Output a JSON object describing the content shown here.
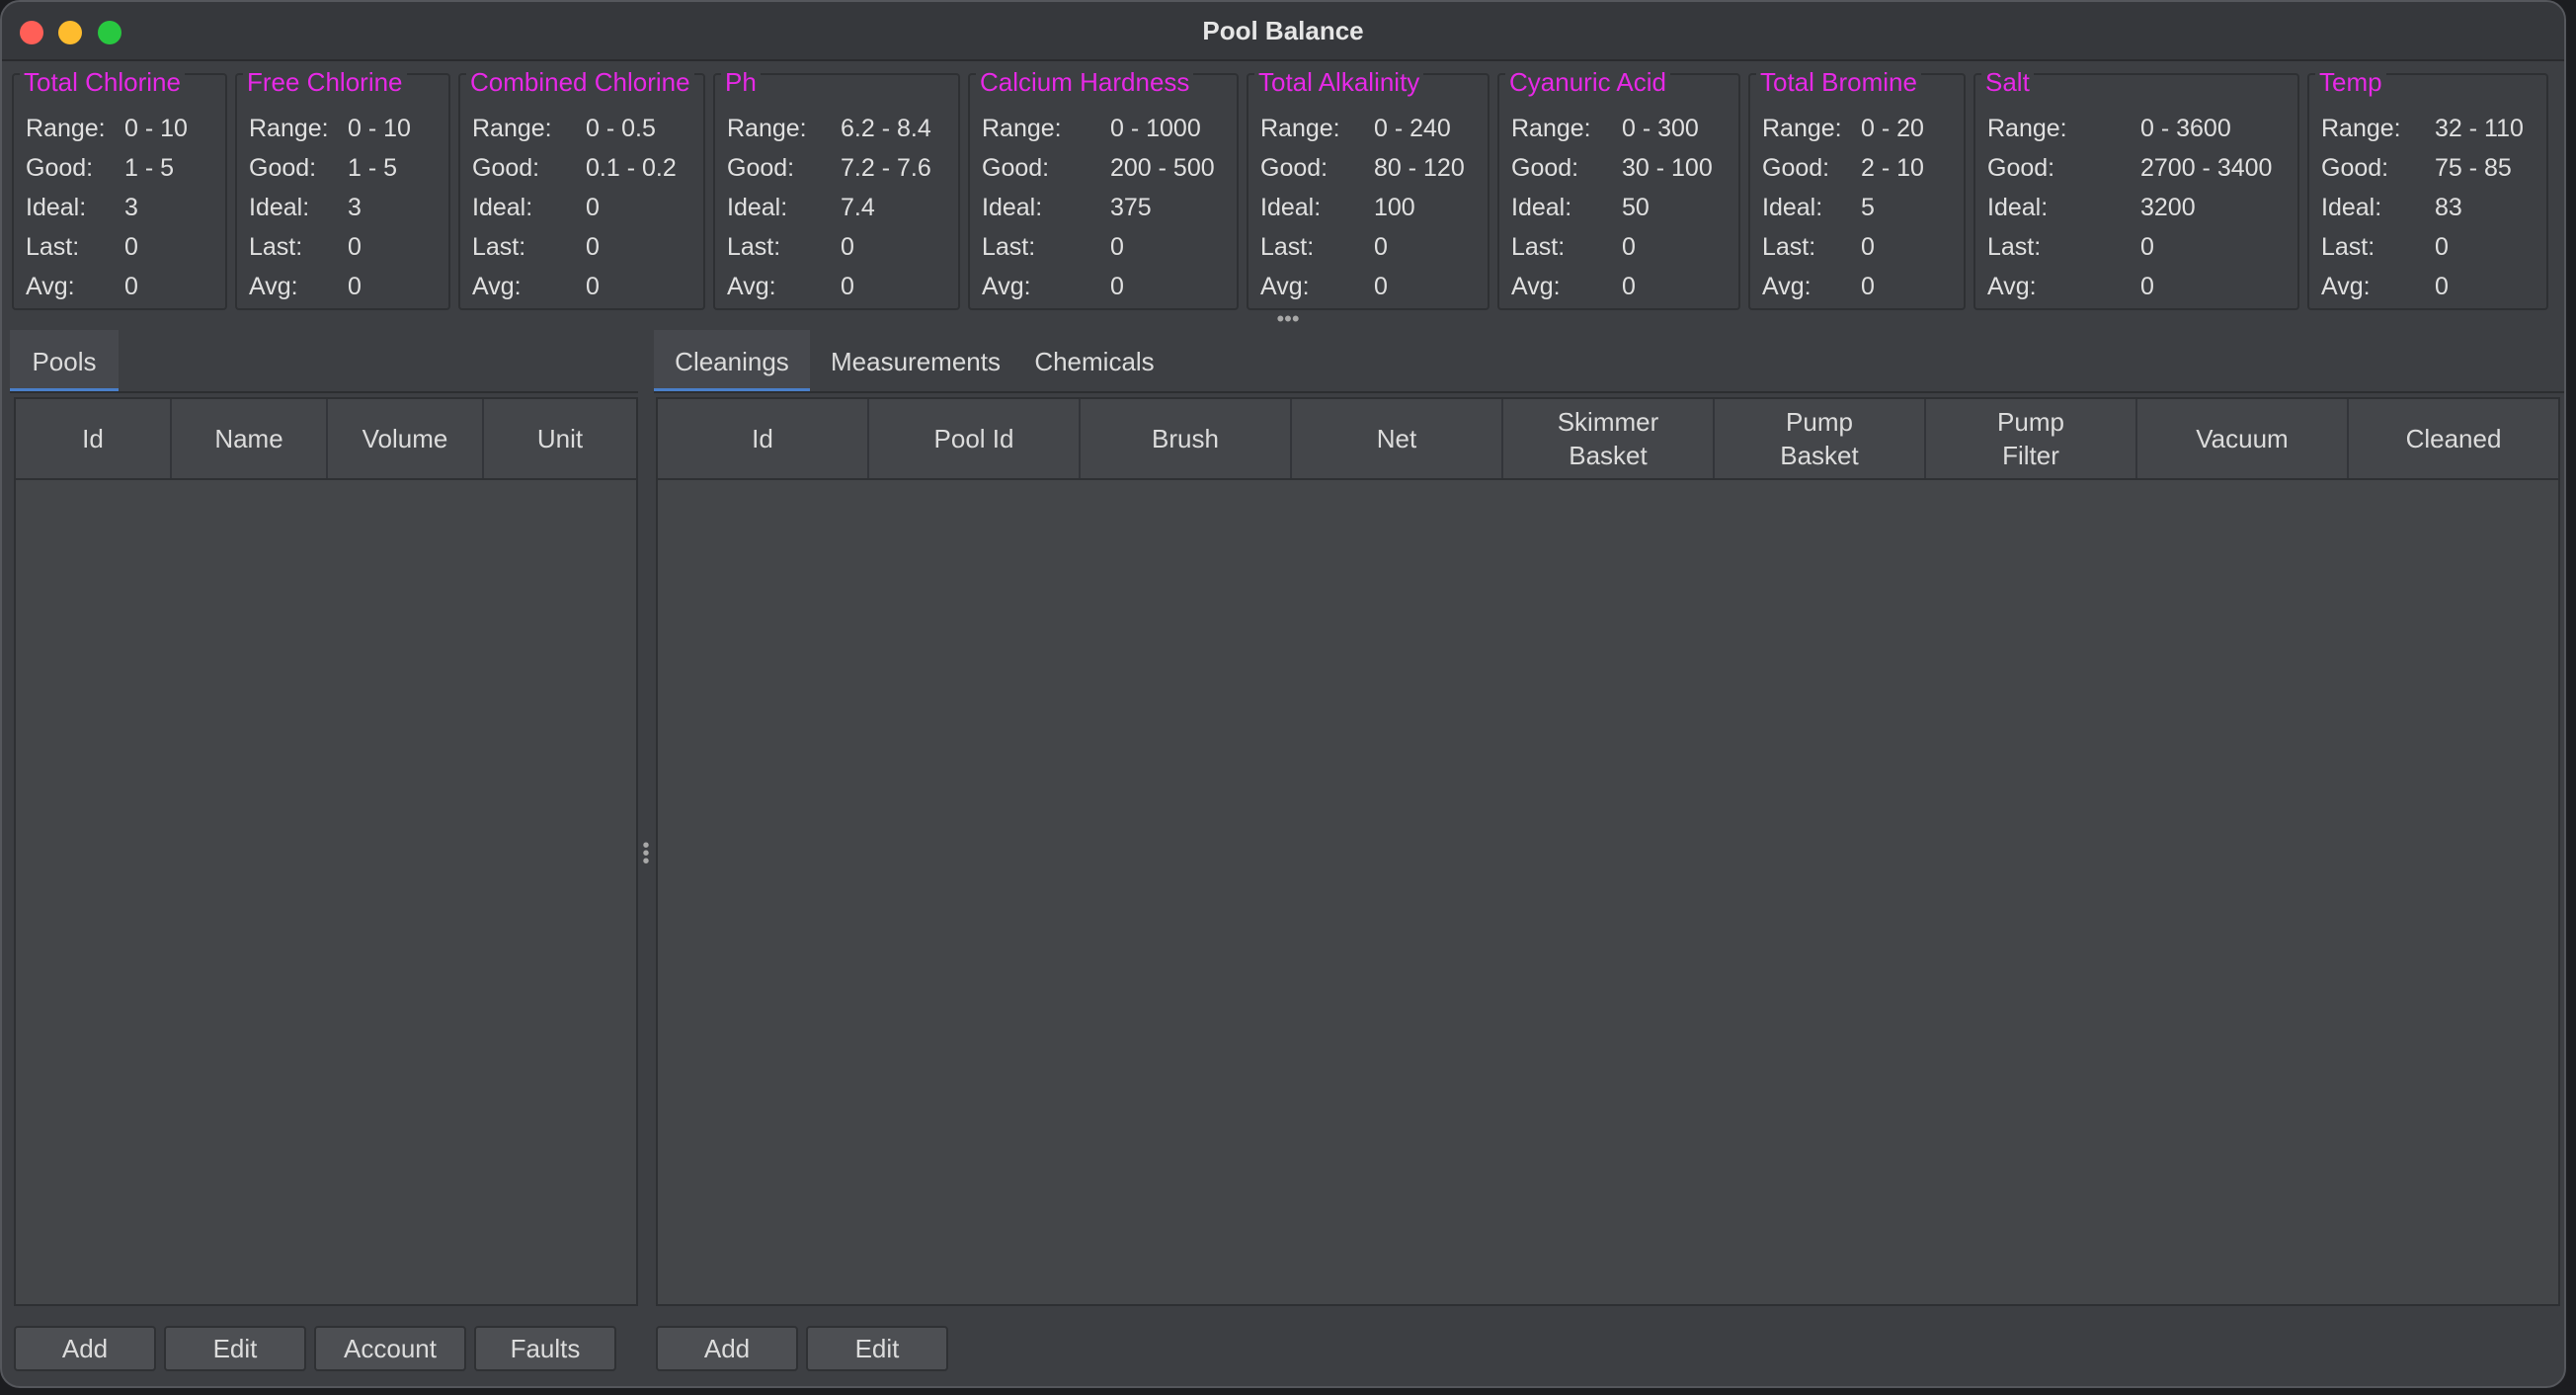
{
  "window": {
    "title": "Pool Balance"
  },
  "parameters": [
    {
      "name": "Total Chlorine",
      "range": "0 - 10",
      "good": "1 - 5",
      "ideal": "3",
      "last": "0",
      "avg": "0"
    },
    {
      "name": "Free Chlorine",
      "range": "0 - 10",
      "good": "1 - 5",
      "ideal": "3",
      "last": "0",
      "avg": "0"
    },
    {
      "name": "Combined Chlorine",
      "range": "0 - 0.5",
      "good": "0.1 - 0.2",
      "ideal": "0",
      "last": "0",
      "avg": "0"
    },
    {
      "name": "Ph",
      "range": "6.2 - 8.4",
      "good": "7.2 - 7.6",
      "ideal": "7.4",
      "last": "0",
      "avg": "0"
    },
    {
      "name": "Calcium Hardness",
      "range": "0 - 1000",
      "good": "200 - 500",
      "ideal": "375",
      "last": "0",
      "avg": "0"
    },
    {
      "name": "Total Alkalinity",
      "range": "0 - 240",
      "good": "80 - 120",
      "ideal": "100",
      "last": "0",
      "avg": "0"
    },
    {
      "name": "Cyanuric Acid",
      "range": "0 - 300",
      "good": "30 - 100",
      "ideal": "50",
      "last": "0",
      "avg": "0"
    },
    {
      "name": "Total Bromine",
      "range": "0 - 20",
      "good": "2 - 10",
      "ideal": "5",
      "last": "0",
      "avg": "0"
    },
    {
      "name": "Salt",
      "range": "0 - 3600",
      "good": "2700 - 3400",
      "ideal": "3200",
      "last": "0",
      "avg": "0"
    },
    {
      "name": "Temp",
      "range": "32 - 110",
      "good": "75 - 85",
      "ideal": "83",
      "last": "0",
      "avg": "0"
    }
  ],
  "labels": {
    "range": "Range:",
    "good": "Good:",
    "ideal": "Ideal:",
    "last": "Last:",
    "avg": "Avg:"
  },
  "left_pane": {
    "tabs": [
      {
        "label": "Pools",
        "active": true
      }
    ],
    "columns": [
      "Id",
      "Name",
      "Volume",
      "Unit"
    ],
    "rows": [],
    "buttons": [
      "Add",
      "Edit",
      "Account",
      "Faults"
    ]
  },
  "right_pane": {
    "tabs": [
      {
        "label": "Cleanings",
        "active": true
      },
      {
        "label": "Measurements",
        "active": false
      },
      {
        "label": "Chemicals",
        "active": false
      }
    ],
    "columns": [
      "Id",
      "Pool Id",
      "Brush",
      "Net",
      "Skimmer\nBasket",
      "Pump\nBasket",
      "Pump\nFilter",
      "Vacuum",
      "Cleaned"
    ],
    "rows": [],
    "buttons": [
      "Add",
      "Edit"
    ]
  },
  "colors": {
    "param_title": "#e629e6",
    "tab_underline": "#4a7fc9",
    "background": "#3d3f43"
  }
}
